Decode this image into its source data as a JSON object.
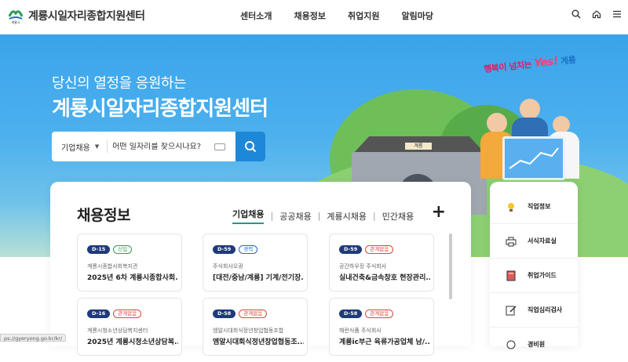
{
  "header": {
    "logo_text": "계룡시일자리종합지원센터",
    "logo_small": "계룡시",
    "nav": [
      "센터소개",
      "채용정보",
      "취업지원",
      "알림마당"
    ],
    "icons": [
      "search-icon",
      "home-icon",
      "menu-icon"
    ]
  },
  "hero": {
    "subtitle": "당신의 열정을 응원하는",
    "title": "계룡시일자리종합지원센터",
    "slogan_1": "행복이 넘치는",
    "slogan_yes": "Yes!",
    "slogan_2": "계룡",
    "gate_sign": "계룡",
    "search": {
      "category": "기업채용",
      "placeholder": "어떤 일자리를 찾으시나요?"
    }
  },
  "jobs": {
    "title": "채용정보",
    "tabs": [
      "기업채용",
      "공공채용",
      "계룡시채용",
      "민간채용"
    ],
    "more": "+",
    "cards": [
      {
        "dday": "D-15",
        "tag": "신입",
        "tag_color": "green",
        "org": "계룡시종합사회복지관",
        "title": "2025년 6차 계룡시종합사회..."
      },
      {
        "dday": "D-59",
        "tag": "경력",
        "tag_color": "blue",
        "org": "주식회사오광",
        "title": "[대전/중남/계룡] 기계/전기장..."
      },
      {
        "dday": "D-59",
        "tag": "관계없음",
        "tag_color": "red",
        "org": "공간하우징 주식회사",
        "title": "실내건축&금속창호 현장관리..."
      },
      {
        "dday": "D-16",
        "tag": "관계없음",
        "tag_color": "red",
        "org": "계룡시청소년상담복지센터",
        "title": "2025년 계룡시청소년상담복..."
      },
      {
        "dday": "D-58",
        "tag": "관계없음",
        "tag_color": "red",
        "org": "엠알시대회식정년창업협동조합",
        "title": "엠알시대회식정년창업협동조..."
      },
      {
        "dday": "D-58",
        "tag": "관계없음",
        "tag_color": "red",
        "org": "해런식품 주식회사",
        "title": "계룡ic부근 육류가공업체 남/..."
      }
    ]
  },
  "quick": [
    {
      "label": "직업정보",
      "icon": "lightbulb-icon"
    },
    {
      "label": "서식자료실",
      "icon": "printer-icon"
    },
    {
      "label": "취업가이드",
      "icon": "book-icon"
    },
    {
      "label": "직업심리검사",
      "icon": "edit-icon"
    },
    {
      "label": "경비원",
      "icon": "badge-icon"
    }
  ],
  "status_url": "ps://gyeryong.go.kr/kr/",
  "colors": {
    "accent": "#1e88d8",
    "tab_underline": "#1e9a8a",
    "dday": "#1f3a7a"
  }
}
